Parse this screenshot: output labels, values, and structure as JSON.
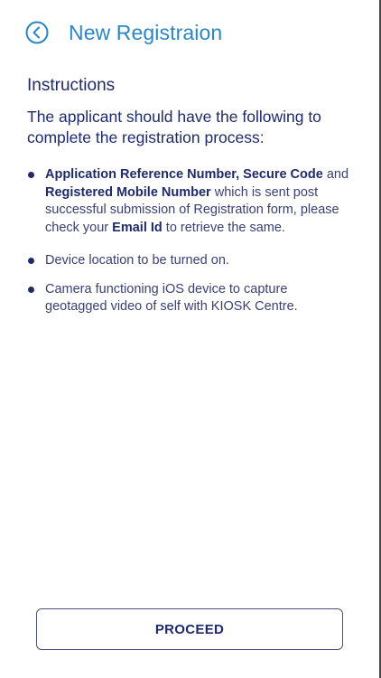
{
  "header": {
    "back_icon": "chevron-left-circle-icon",
    "title": "New Registraion"
  },
  "instructions": {
    "heading": "Instructions",
    "intro": "The applicant should have the following to complete the registration process:",
    "items": [
      {
        "segments": [
          {
            "text": "Application Reference Number, Secure Code",
            "bold": true
          },
          {
            "text": " and ",
            "bold": false
          },
          {
            "text": "Registered Mobile Number",
            "bold": true
          },
          {
            "text": " which is sent post successful submission of Registration form, please check your ",
            "bold": false
          },
          {
            "text": "Email Id",
            "bold": true
          },
          {
            "text": " to retrieve the same.",
            "bold": false
          }
        ]
      },
      {
        "segments": [
          {
            "text": "Device location to be turned on.",
            "bold": false
          }
        ]
      },
      {
        "segments": [
          {
            "text": "Camera functioning iOS device to capture geotagged video of self with KIOSK Centre.",
            "bold": false
          }
        ]
      }
    ]
  },
  "footer": {
    "proceed_label": "PROCEED"
  },
  "colors": {
    "title": "#2a86c8",
    "text_primary": "#1f2a6b",
    "text_body": "#3b4077",
    "button_border": "#4b5285"
  }
}
